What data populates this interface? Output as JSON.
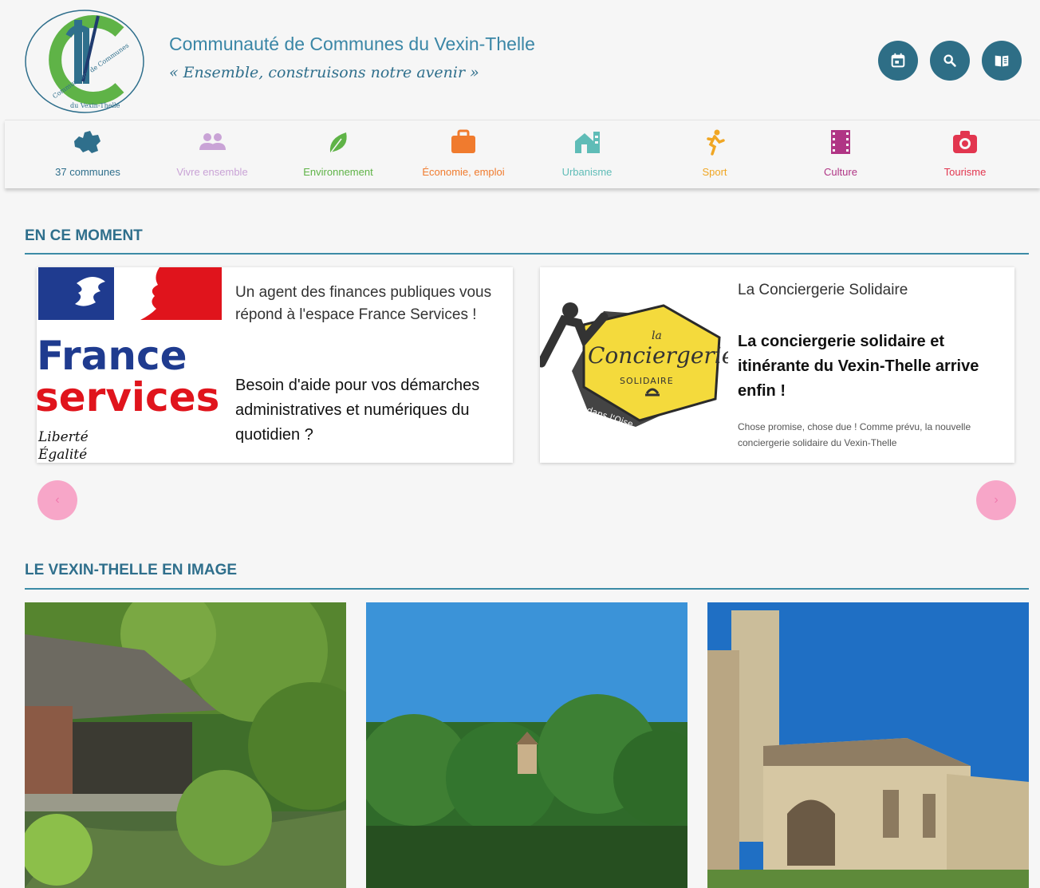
{
  "header": {
    "title": "Communauté de Communes du Vexin-Thelle",
    "motto": "« Ensemble, construisons notre avenir »",
    "logo_text": "Communauté de Communes du Vexin-Thelle",
    "buttons": [
      {
        "icon": "calendar-icon"
      },
      {
        "icon": "search-icon"
      },
      {
        "icon": "book-icon"
      }
    ]
  },
  "nav": {
    "items": [
      {
        "label": "37 communes",
        "color": "#2f6f8c",
        "icon": "map-icon"
      },
      {
        "label": "Vivre ensemble",
        "color": "#c9a3d6",
        "icon": "people-icon"
      },
      {
        "label": "Environnement",
        "color": "#5fb347",
        "icon": "leaf-icon"
      },
      {
        "label": "Économie, emploi",
        "color": "#f07b2e",
        "icon": "briefcase-icon"
      },
      {
        "label": "Urbanisme",
        "color": "#5fbcb7",
        "icon": "house-icon"
      },
      {
        "label": "Sport",
        "color": "#f0a623",
        "icon": "runner-icon"
      },
      {
        "label": "Culture",
        "color": "#b03585",
        "icon": "film-icon"
      },
      {
        "label": "Tourisme",
        "color": "#e2364f",
        "icon": "camera-icon"
      }
    ]
  },
  "news": {
    "title": "EN CE MOMENT",
    "cards": [
      {
        "logo_word1": "France",
        "logo_word2": "services",
        "logo_motto1": "Liberté",
        "logo_motto2": "Égalité",
        "intro": "Un agent des finances publiques vous répond à l'espace France Services !",
        "lead": "Besoin d'aide pour vos démarches administratives et numériques du quotidien ?"
      },
      {
        "logo_word": "Conciergerie",
        "logo_top": "la",
        "logo_sub": "SOLIDAIRE",
        "logo_ribbon": "dans l'Oise",
        "tag": "La Conciergerie Solidaire",
        "headline": "La conciergerie solidaire et itinérante du Vexin-Thelle arrive enfin !",
        "excerpt": "Chose promise, chose due ! Comme prévu, la nouvelle conciergerie solidaire du Vexin-Thelle"
      }
    ],
    "prev_label": "‹",
    "next_label": "›"
  },
  "gallery": {
    "title": "LE VEXIN-THELLE EN IMAGE"
  },
  "colors": {
    "primary": "#2f6f8c",
    "accent_pink": "#f7a6c8",
    "france_blue": "#1f3b8f",
    "france_red": "#e0141c",
    "concierge_yellow": "#f4da3c"
  }
}
